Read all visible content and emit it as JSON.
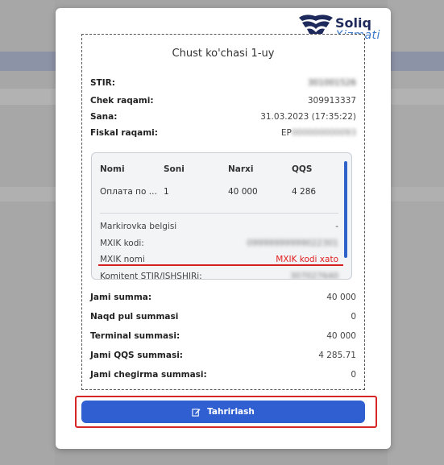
{
  "logo": {
    "line1": "Soliq",
    "line2": "Xizmati"
  },
  "receipt": {
    "title": "Chust ko'chasi 1-uy",
    "fields": [
      {
        "label": "STIR:",
        "value": "301001526",
        "blurred": true
      },
      {
        "label": "Chek raqami:",
        "value": "309913337",
        "blurred": false
      },
      {
        "label": "Sana:",
        "value": "31.03.2023 (17:35:22)",
        "blurred": false
      },
      {
        "label": "Fiskal raqami:",
        "value": "EP000000000093",
        "blurred": false
      }
    ],
    "items": {
      "headers": [
        "Nomi",
        "Soni",
        "Narxi",
        "QQS"
      ],
      "row": [
        "Оплата по ...",
        "1",
        "40 000",
        "4 286"
      ],
      "details": [
        {
          "label": "Markirovka belgisi",
          "value": "-"
        },
        {
          "label": "MXIK kodi:",
          "value": "09999999999022301"
        },
        {
          "label": "MXIK nomi",
          "value": "MXIK kodi xato"
        },
        {
          "label": "Komitent STIR/JSHSHIRi:",
          "value": "307027640"
        }
      ]
    },
    "totals": [
      {
        "label": "Jami summa:",
        "value": "40 000"
      },
      {
        "label": "Naqd pul summasi",
        "value": "0"
      },
      {
        "label": "Terminal summasi:",
        "value": "40 000"
      },
      {
        "label": "Jami QQS summasi:",
        "value": "4 285.71"
      },
      {
        "label": "Jami chegirma summasi:",
        "value": "0"
      }
    ]
  },
  "edit_button": {
    "label": "Tahrirlash"
  },
  "colors": {
    "accent": "#2f5fd0",
    "error": "#e02020",
    "highlight": "#d62626"
  }
}
